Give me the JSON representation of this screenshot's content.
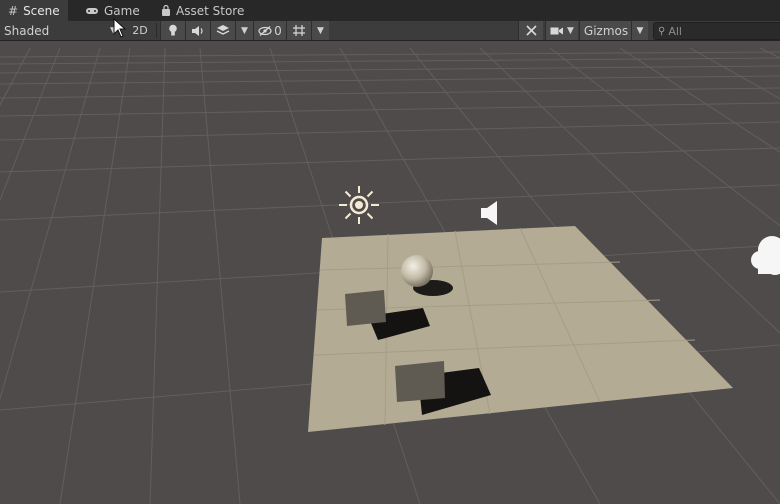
{
  "tabs": [
    {
      "label": "Scene",
      "icon": "grid-icon",
      "active": true
    },
    {
      "label": "Game",
      "icon": "gamepad-icon",
      "active": false
    },
    {
      "label": "Asset Store",
      "icon": "shopping-bag-icon",
      "active": false
    }
  ],
  "toolbar": {
    "shading_mode": "Shaded",
    "two_d_label": "2D",
    "hidden_count": "0",
    "gizmos_label": "Gizmos"
  },
  "search": {
    "placeholder": "All"
  },
  "scene": {
    "background": "#4e4b4a",
    "plane_color": "#b4ab94",
    "sun_icon": "directional-light-icon",
    "audio_icon": "audio-source-icon",
    "sky_icon": "cloud-icon"
  }
}
